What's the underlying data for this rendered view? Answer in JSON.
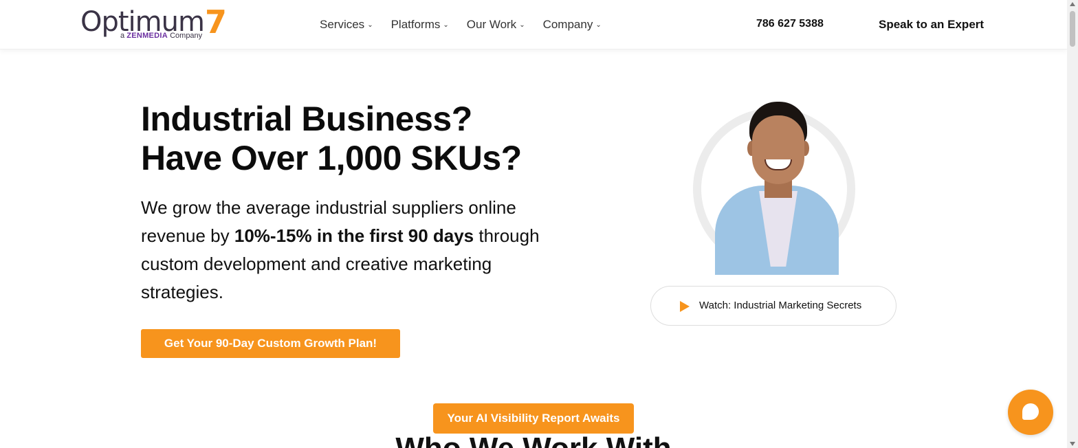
{
  "header": {
    "logo": {
      "word": "Optimum",
      "number": "7",
      "sub_prefix": "a",
      "sub_brand": "ZENMEDIA",
      "sub_suffix": "Company"
    },
    "nav": [
      {
        "label": "Services"
      },
      {
        "label": "Platforms"
      },
      {
        "label": "Our Work"
      },
      {
        "label": "Company"
      }
    ],
    "phone": "786 627 5388",
    "cta": "Speak to an Expert"
  },
  "hero": {
    "title_line1": "Industrial Business?",
    "title_line2": "Have Over 1,000 SKUs?",
    "text_before": "We grow the average industrial suppliers online revenue by ",
    "text_bold": "10%-15% in the first 90 days",
    "text_after": " through custom development and creative marketing strategies.",
    "button": "Get Your 90-Day Custom Growth Plan!"
  },
  "video": {
    "label": "Watch: Industrial Marketing Secrets"
  },
  "banner": {
    "ai_report": "Your AI Visibility Report Awaits"
  },
  "section": {
    "title": "Who We Work With"
  },
  "colors": {
    "accent": "#f7941d",
    "brand_purple": "#6b2fa0",
    "text": "#111111"
  },
  "icons": {
    "play": "play-icon",
    "chat": "chat-icon",
    "chevron": "chevron-down-icon"
  }
}
